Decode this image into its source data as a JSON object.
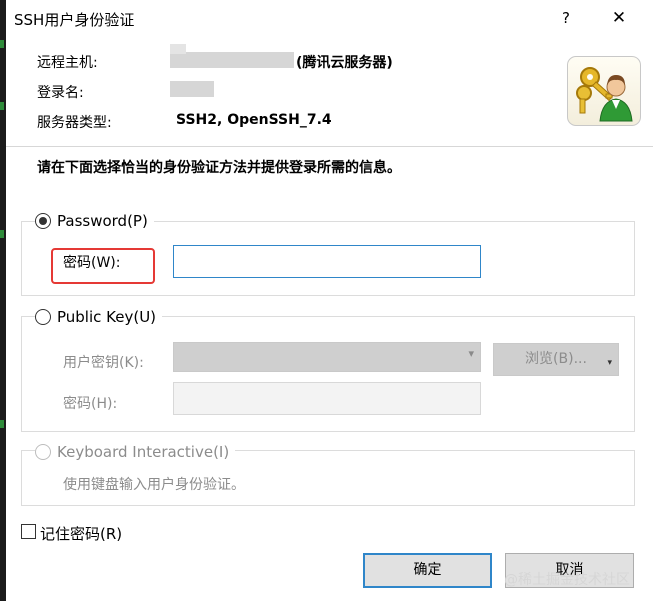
{
  "window": {
    "title": "SSH用户身份验证",
    "help_glyph": "?",
    "close_glyph": "✕"
  },
  "info": {
    "host_label": "远程主机:",
    "host_suffix": "(腾讯云服务器)",
    "login_label": "登录名:",
    "server_type_label": "服务器类型:",
    "server_type_value": "SSH2, OpenSSH_7.4"
  },
  "icon": "keys-user-icon",
  "instruction": "请在下面选择恰当的身份验证方法并提供登录所需的信息。",
  "methods": {
    "password": {
      "label": "Password(P)",
      "selected": true,
      "field_label": "密码(W):",
      "value": ""
    },
    "public_key": {
      "label": "Public Key(U)",
      "selected": false,
      "key_label": "用户密钥(K):",
      "browse_label": "浏览(B)...",
      "passphrase_label": "密码(H):"
    },
    "keyboard_interactive": {
      "label": "Keyboard Interactive(I)",
      "selected": false,
      "description": "使用键盘输入用户身份验证。"
    }
  },
  "remember_password": {
    "label": "记住密码(R)",
    "checked": false
  },
  "buttons": {
    "ok": "确定",
    "cancel": "取消"
  },
  "watermark": "@稀土掘金技术社区"
}
